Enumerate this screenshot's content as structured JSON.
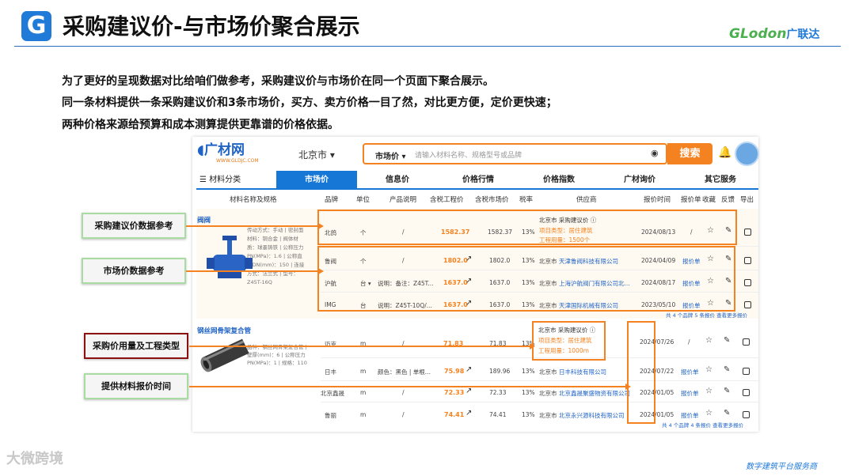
{
  "slide": {
    "logo_letter": "G",
    "title": "采购建议价-与市场价聚合展示",
    "brand": "GLodon",
    "brand_cn": "广联达"
  },
  "intro": [
    "为了更好的呈现数据对比给咱们做参考，采购建议价与市场价在同一个页面下聚合展示。",
    "同一条材料提供一条采购建议价和3条市场价，买方、卖方价格一目了然，对比更方便，定价更快速；",
    "两种价格来源给预算和成本测算提供更靠谱的价格依据。"
  ],
  "site": {
    "logo": "广材网",
    "logo_sub": "WWW.GLDJC.COM",
    "city": "北京市 ▾",
    "search_type": "市场价 ▾",
    "search_placeholder": "请输入材料名称、规格型号或品牌",
    "search_button": "搜索"
  },
  "tabs": {
    "category": "☰ 材料分类",
    "items": [
      "市场价",
      "信息价",
      "价格行情",
      "价格指数",
      "广材询价",
      "其它服务"
    ]
  },
  "headers": [
    "材料名称及规格",
    "品牌",
    "单位",
    "产品说明",
    "含税工程价",
    "含税市场价",
    "税率",
    "供应商",
    "报价时间",
    "报价单",
    "收藏",
    "反馈",
    "导出"
  ],
  "group1": {
    "name": "阀阀",
    "spec": "传动方式：手动 | 密封面材料：铜合金 | 阀体材质：球墨铸铁 | 公称压力PN(MPa)：1.6 | 公称直径DN(mm)：150 | 连接方式：法兰式 | 型号：Z45T-16Q",
    "rows": [
      {
        "brand": "北鸽",
        "unit": "个",
        "desc": "/",
        "eng": "1582.37",
        "mkt": "1582.37",
        "tax": "13%",
        "sup1": "北京市 采购建议价 ⓘ",
        "sup2": "项目类型：居住建筑",
        "sup3": "工程用量：1500个",
        "time": "2024/08/13",
        "quote": "/"
      },
      {
        "brand": "鲁阀",
        "unit": "个",
        "desc": "/",
        "eng": "1802.0",
        "mkt": "1802.0",
        "tax": "13%",
        "sup1": "北京市",
        "sup2": "天津鲁阀科技有限公司",
        "time": "2024/04/09",
        "quote": "报价单"
      },
      {
        "brand": "沪航",
        "unit": "台 ▾",
        "desc": "说明：备注：Z45T...",
        "eng": "1637.0",
        "mkt": "1637.0",
        "tax": "13%",
        "sup1": "北京市",
        "sup2": "上海沪航阀门有限公司北...",
        "time": "2024/08/17",
        "quote": "报价单"
      },
      {
        "brand": "IMG",
        "unit": "台",
        "desc": "说明：Z45T-10Q/...",
        "eng": "1637.0",
        "mkt": "1637.0",
        "tax": "13%",
        "sup1": "北京市",
        "sup2": "天津国际机械有限公司",
        "time": "2023/05/10",
        "quote": "报价单"
      }
    ],
    "more": "共 4 个品牌 5 条报价 查看更多报价"
  },
  "group2": {
    "name": "钢丝网骨架复合管",
    "spec": "品种：钢丝网骨架复合管 | 壁厚(mm)：6 | 公称压力PN(MPa)：1 | 规格：110",
    "rows": [
      {
        "brand": "迈克",
        "unit": "m",
        "desc": "/",
        "eng": "71.83",
        "mkt": "71.83",
        "tax": "13%",
        "sup1": "北京市 采购建议价 ⓘ",
        "sup2": "项目类型：居住建筑",
        "sup3": "工程用量：1000m",
        "time": "2024/07/26",
        "quote": "/"
      },
      {
        "brand": "日丰",
        "unit": "m",
        "desc": "颜色：黑色 | 单根...",
        "eng": "75.98",
        "mkt": "189.96",
        "tax": "13%",
        "sup1": "北京市",
        "sup2": "日丰科技有限公司",
        "time": "2024/07/22",
        "quote": "报价单"
      },
      {
        "brand": "北京鑫晟",
        "unit": "m",
        "desc": "/",
        "eng": "72.33",
        "mkt": "72.33",
        "tax": "13%",
        "sup1": "北京市",
        "sup2": "北京鑫晟聚盛物资有限公司",
        "time": "2024/01/05",
        "quote": "报价单"
      },
      {
        "brand": "鲁丽",
        "unit": "m",
        "desc": "/",
        "eng": "74.41",
        "mkt": "74.41",
        "tax": "13%",
        "sup1": "北京市",
        "sup2": "北京永兴源科技有限公司",
        "time": "2024/01/05",
        "quote": "报价单"
      }
    ],
    "more": "共 4 个品牌 4 条报价 查看更多报价"
  },
  "callouts": [
    "采购建议价数据参考",
    "市场价数据参考",
    "采购价用量及工程类型",
    "提供材料报价时间"
  ],
  "watermark": "大微跨境",
  "footer": "数字建筑平台服务商"
}
